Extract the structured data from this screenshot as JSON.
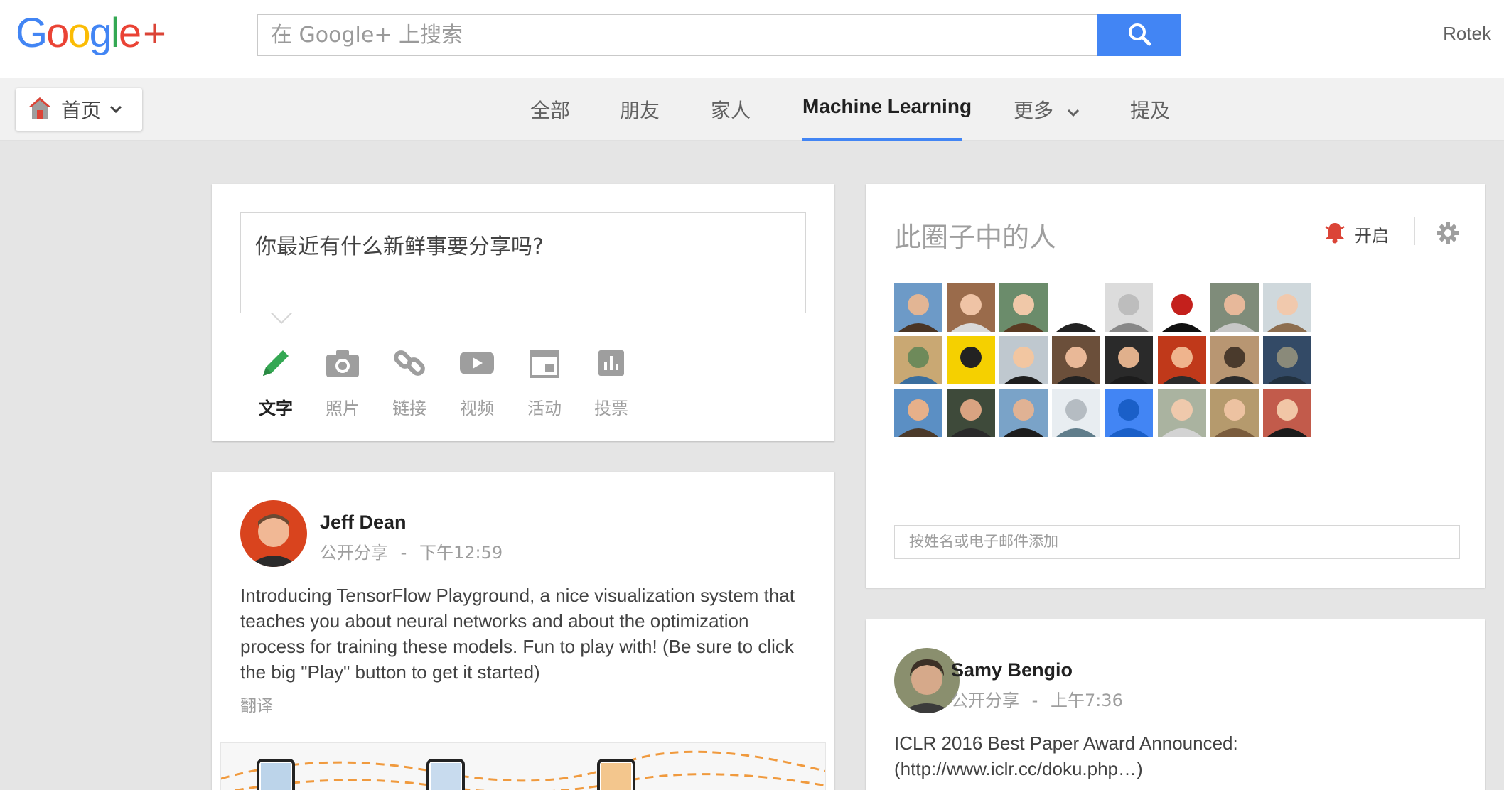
{
  "brand": {
    "logo_letters": [
      "G",
      "o",
      "o",
      "g",
      "l",
      "e"
    ],
    "logo_colors": [
      "#4285f4",
      "#ea4335",
      "#fbbc05",
      "#4285f4",
      "#34a853",
      "#ea4335"
    ],
    "logo_plus": "+",
    "accent": "#4285f4"
  },
  "header": {
    "search_placeholder": "在 Google+ 上搜索",
    "search_icon": "search-icon",
    "user_name": "Rotek"
  },
  "nav": {
    "home_label": "首页",
    "tabs": [
      {
        "label": "全部"
      },
      {
        "label": "朋友"
      },
      {
        "label": "家人"
      },
      {
        "label": "Machine Learning",
        "active": true
      },
      {
        "label": "更多"
      },
      {
        "label": "提及"
      }
    ]
  },
  "composer": {
    "prompt": "你最近有什么新鲜事要分享吗?",
    "post_types": [
      {
        "label": "文字",
        "icon": "pencil-icon",
        "active": true
      },
      {
        "label": "照片",
        "icon": "camera-icon"
      },
      {
        "label": "链接",
        "icon": "link-icon"
      },
      {
        "label": "视频",
        "icon": "video-icon"
      },
      {
        "label": "活动",
        "icon": "event-icon"
      },
      {
        "label": "投票",
        "icon": "poll-icon"
      }
    ]
  },
  "post1": {
    "author": "Jeff Dean",
    "visibility": "公开分享",
    "separator": "-",
    "time": "下午12:59",
    "body": "Introducing TensorFlow Playground, a nice visualization system that teaches you about neural networks and about the optimization process for training these models. Fun to play with! (Be sure to click the big \"Play\" button to get it started)",
    "translate": "翻译"
  },
  "circle": {
    "title": "此圈子中的人",
    "notify_label": "开启",
    "add_placeholder": "按姓名或电子邮件添加",
    "member_count_visible": 24
  },
  "post2": {
    "author": "Samy Bengio",
    "visibility": "公开分享",
    "separator": "-",
    "time": "上午7:36",
    "body_line1": "ICLR 2016 Best Paper Award Announced:",
    "body_line2": "(http://www.iclr.cc/doku.php…)"
  }
}
